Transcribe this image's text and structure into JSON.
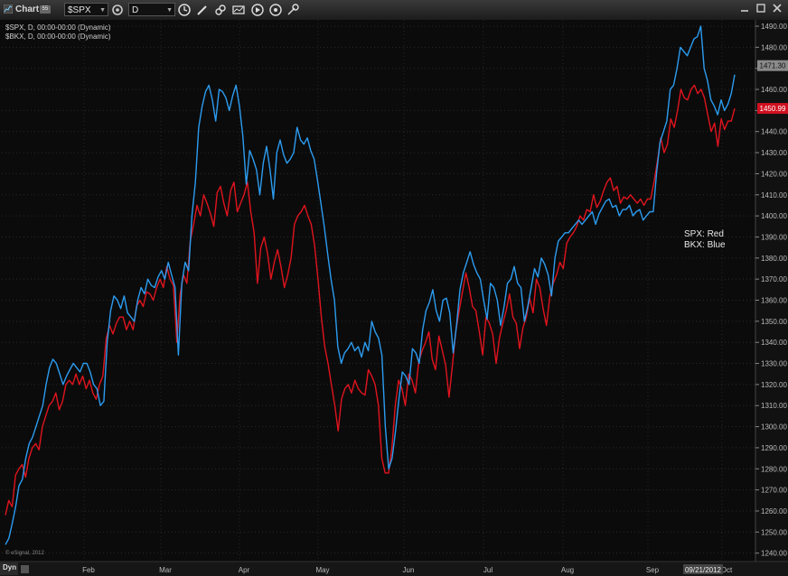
{
  "window": {
    "title": "Chart",
    "badge": "55",
    "symbol_value": "$SPX",
    "interval_value": "D"
  },
  "legend": [
    "$SPX, D, 00:00-00:00 (Dynamic)",
    "$BKX, D, 00:00-00:00 (Dynamic)"
  ],
  "annotation": [
    "SPX:  Red",
    "BKX:  Blue"
  ],
  "footer": {
    "copyright": "© eSignal, 2012",
    "dyn_label": "Dyn",
    "cursor_date": "09/21/2012"
  },
  "colors": {
    "spx": "#e0141e",
    "bkx": "#2c9cf0",
    "background": "#0b0b0b"
  },
  "icons": [
    "chart-window-icon",
    "symbol-dropdown-icon",
    "interval-dropdown-icon",
    "clock-icon",
    "pencil-icon",
    "link-icon",
    "chart-type-icon",
    "play-icon",
    "refresh-icon",
    "pin-icon",
    "minimize-icon",
    "maximize-icon",
    "close-icon"
  ],
  "chart_data": {
    "type": "line",
    "y_ticks": [
      1240,
      1250,
      1260,
      1270,
      1280,
      1290,
      1300,
      1310,
      1320,
      1330,
      1340,
      1350,
      1360,
      1370,
      1380,
      1390,
      1400,
      1410,
      1420,
      1430,
      1440,
      1450,
      1460,
      1470,
      1480,
      1490
    ],
    "ylim": [
      1236,
      1493
    ],
    "x_ticks": [
      "Feb",
      "Mar",
      "Apr",
      "May",
      "Jun",
      "Jul",
      "Aug",
      "Sep",
      "Oct"
    ],
    "last_values": {
      "spx": "1450.99",
      "bkx": "1471.30"
    },
    "grid": true,
    "series": [
      {
        "name": "SPX",
        "color": "#e0141e",
        "values": [
          1258,
          1265,
          1262,
          1277,
          1280,
          1282,
          1276,
          1285,
          1290,
          1292,
          1289,
          1300,
          1305,
          1310,
          1312,
          1316,
          1308,
          1312,
          1320,
          1322,
          1320,
          1325,
          1320,
          1324,
          1318,
          1322,
          1316,
          1313,
          1320,
          1324,
          1342,
          1348,
          1344,
          1349,
          1352,
          1352,
          1346,
          1350,
          1346,
          1357,
          1360,
          1357,
          1364,
          1363,
          1360,
          1366,
          1370,
          1366,
          1376,
          1370,
          1367,
          1340,
          1363,
          1372,
          1368,
          1388,
          1396,
          1405,
          1400,
          1410,
          1406,
          1401,
          1395,
          1411,
          1414,
          1406,
          1400,
          1412,
          1416,
          1402,
          1406,
          1410,
          1416,
          1402,
          1392,
          1368,
          1385,
          1390,
          1382,
          1370,
          1378,
          1384,
          1376,
          1366,
          1372,
          1380,
          1396,
          1400,
          1402,
          1405,
          1400,
          1396,
          1386,
          1370,
          1352,
          1338,
          1330,
          1320,
          1310,
          1298,
          1313,
          1318,
          1320,
          1316,
          1322,
          1318,
          1316,
          1315,
          1327,
          1324,
          1320,
          1310,
          1285,
          1278,
          1278,
          1290,
          1310,
          1322,
          1318,
          1310,
          1325,
          1322,
          1316,
          1331,
          1336,
          1340,
          1345,
          1332,
          1327,
          1343,
          1336,
          1329,
          1314,
          1329,
          1345,
          1355,
          1364,
          1373,
          1366,
          1357,
          1355,
          1345,
          1334,
          1352,
          1349,
          1344,
          1330,
          1342,
          1349,
          1355,
          1363,
          1352,
          1349,
          1337,
          1347,
          1352,
          1361,
          1354,
          1370,
          1366,
          1356,
          1348,
          1362,
          1368,
          1372,
          1378,
          1375,
          1387,
          1390,
          1392,
          1395,
          1400,
          1398,
          1403,
          1402,
          1410,
          1404,
          1407,
          1412,
          1416,
          1418,
          1412,
          1414,
          1406,
          1409,
          1408,
          1410,
          1408,
          1406,
          1408,
          1405,
          1408,
          1408,
          1416,
          1426,
          1437,
          1430,
          1434,
          1446,
          1442,
          1450,
          1460,
          1456,
          1455,
          1460,
          1462,
          1458,
          1460,
          1456,
          1448,
          1440,
          1444,
          1433,
          1446,
          1441,
          1445,
          1445,
          1451
        ]
      },
      {
        "name": "BKX",
        "color": "#2c9cf0",
        "values": [
          1244,
          1247,
          1254,
          1262,
          1272,
          1275,
          1285,
          1292,
          1295,
          1300,
          1305,
          1310,
          1320,
          1328,
          1332,
          1330,
          1325,
          1320,
          1324,
          1327,
          1330,
          1328,
          1326,
          1330,
          1330,
          1326,
          1320,
          1318,
          1310,
          1312,
          1340,
          1355,
          1362,
          1360,
          1356,
          1362,
          1354,
          1352,
          1350,
          1360,
          1366,
          1363,
          1370,
          1367,
          1366,
          1371,
          1374,
          1370,
          1378,
          1372,
          1366,
          1334,
          1368,
          1378,
          1374,
          1400,
          1416,
          1442,
          1452,
          1459,
          1462,
          1455,
          1445,
          1460,
          1459,
          1456,
          1450,
          1457,
          1462,
          1452,
          1438,
          1415,
          1431,
          1427,
          1422,
          1410,
          1425,
          1433,
          1422,
          1408,
          1430,
          1436,
          1429,
          1425,
          1427,
          1430,
          1442,
          1436,
          1434,
          1437,
          1431,
          1427,
          1417,
          1406,
          1395,
          1382,
          1370,
          1360,
          1338,
          1330,
          1335,
          1337,
          1340,
          1336,
          1338,
          1333,
          1340,
          1336,
          1350,
          1345,
          1342,
          1334,
          1300,
          1280,
          1285,
          1298,
          1313,
          1326,
          1324,
          1320,
          1337,
          1335,
          1330,
          1346,
          1355,
          1359,
          1365,
          1355,
          1350,
          1360,
          1361,
          1354,
          1335,
          1348,
          1365,
          1373,
          1378,
          1383,
          1377,
          1373,
          1370,
          1360,
          1351,
          1368,
          1366,
          1360,
          1348,
          1357,
          1368,
          1370,
          1376,
          1368,
          1366,
          1350,
          1357,
          1366,
          1375,
          1371,
          1380,
          1377,
          1372,
          1362,
          1380,
          1388,
          1390,
          1392,
          1392,
          1394,
          1396,
          1398,
          1396,
          1398,
          1400,
          1402,
          1396,
          1401,
          1404,
          1407,
          1408,
          1404,
          1405,
          1400,
          1403,
          1403,
          1405,
          1400,
          1402,
          1403,
          1398,
          1400,
          1402,
          1402,
          1421,
          1435,
          1440,
          1445,
          1460,
          1462,
          1470,
          1480,
          1478,
          1476,
          1480,
          1484,
          1485,
          1490,
          1470,
          1464,
          1455,
          1452,
          1448,
          1455,
          1450,
          1453,
          1458,
          1467
        ]
      }
    ]
  }
}
